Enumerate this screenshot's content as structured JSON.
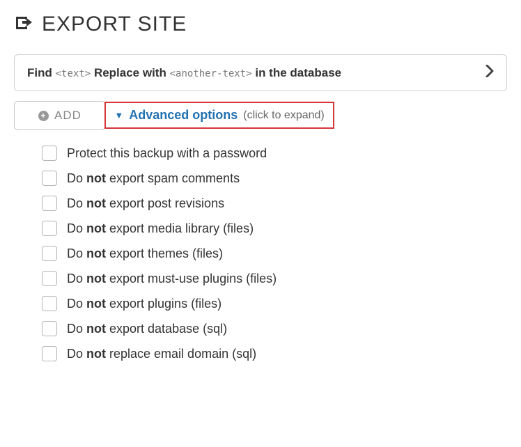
{
  "page": {
    "title": "EXPORT SITE"
  },
  "find_replace": {
    "find_label": "Find",
    "find_placeholder": "<text>",
    "replace_label": "Replace with",
    "replace_placeholder": "<another-text>",
    "tail": "in the database"
  },
  "add": {
    "label": "ADD"
  },
  "advanced": {
    "label": "Advanced options",
    "hint": "(click to expand)"
  },
  "options": [
    {
      "text_before": "Protect this backup with a password",
      "bold": "",
      "text_after": "",
      "checked": false
    },
    {
      "text_before": "Do ",
      "bold": "not",
      "text_after": " export spam comments",
      "checked": false
    },
    {
      "text_before": "Do ",
      "bold": "not",
      "text_after": " export post revisions",
      "checked": false
    },
    {
      "text_before": "Do ",
      "bold": "not",
      "text_after": " export media library (files)",
      "checked": false
    },
    {
      "text_before": "Do ",
      "bold": "not",
      "text_after": " export themes (files)",
      "checked": false
    },
    {
      "text_before": "Do ",
      "bold": "not",
      "text_after": " export must-use plugins (files)",
      "checked": false
    },
    {
      "text_before": "Do ",
      "bold": "not",
      "text_after": " export plugins (files)",
      "checked": false
    },
    {
      "text_before": "Do ",
      "bold": "not",
      "text_after": " export database (sql)",
      "checked": false
    },
    {
      "text_before": "Do ",
      "bold": "not",
      "text_after": " replace email domain (sql)",
      "checked": false
    }
  ]
}
